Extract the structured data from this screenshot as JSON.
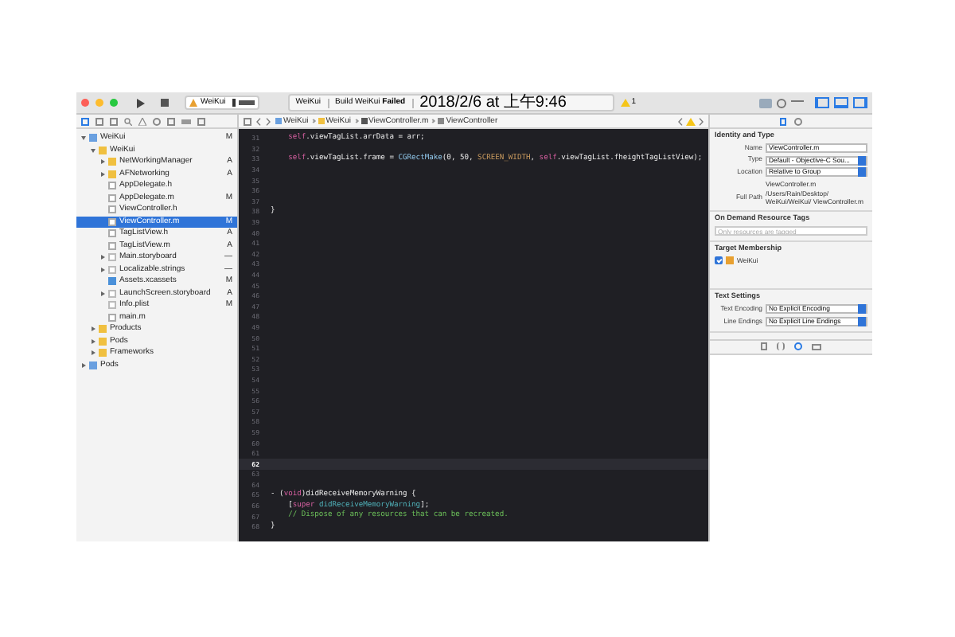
{
  "toolbar": {
    "scheme": "WeiKui",
    "status": {
      "project": "WeiKui",
      "message": "Build WeiKui **Failed**",
      "time": "2018/2/6 at 上午9:46"
    },
    "warning_count": "1"
  },
  "jump_bar": [
    "WeiKui",
    "WeiKui",
    "ViewController.m",
    "ViewController"
  ],
  "navigator": [
    {
      "name": "WeiKui",
      "kind": "project",
      "badge": "M",
      "expanded": true,
      "selected": false,
      "children": [
        {
          "name": "WeiKui",
          "kind": "folder",
          "expanded": true,
          "selected": false,
          "children": [
            {
              "name": "NetWorkingManager",
              "kind": "folder",
              "badge": "A",
              "expanded": false,
              "selected": false
            },
            {
              "name": "AFNetworking",
              "kind": "folder",
              "badge": "A",
              "expanded": false,
              "selected": false
            },
            {
              "name": "AppDelegate.h",
              "kind": "header",
              "selected": false
            },
            {
              "name": "AppDelegate.m",
              "kind": "source",
              "badge": "M",
              "selected": false
            },
            {
              "name": "ViewController.h",
              "kind": "header",
              "selected": false
            },
            {
              "name": "ViewController.m",
              "kind": "source",
              "badge": "M",
              "selected": true
            },
            {
              "name": "TagListView.h",
              "kind": "header",
              "badge": "A",
              "selected": false
            },
            {
              "name": "TagListView.m",
              "kind": "source",
              "badge": "A",
              "selected": false
            },
            {
              "name": "Main.storyboard",
              "kind": "doc",
              "badge": "—",
              "expanded": false,
              "selected": false
            },
            {
              "name": "Localizable.strings",
              "kind": "doc",
              "badge": "—",
              "expanded": false,
              "selected": false
            },
            {
              "name": "Assets.xcassets",
              "kind": "assets",
              "badge": "M",
              "selected": false
            },
            {
              "name": "LaunchScreen.storyboard",
              "kind": "doc",
              "badge": "A",
              "expanded": false,
              "selected": false
            },
            {
              "name": "Info.plist",
              "kind": "doc",
              "badge": "M",
              "selected": false
            },
            {
              "name": "main.m",
              "kind": "source",
              "selected": false
            }
          ]
        },
        {
          "name": "Products",
          "kind": "folder",
          "expanded": false,
          "selected": false
        },
        {
          "name": "Pods",
          "kind": "folder",
          "expanded": false,
          "selected": false
        },
        {
          "name": "Frameworks",
          "kind": "folder",
          "expanded": false,
          "selected": false
        }
      ]
    },
    {
      "name": "Pods",
      "kind": "project",
      "expanded": false,
      "selected": false
    }
  ],
  "editor": {
    "lines": [
      {
        "number": "31",
        "current": false,
        "segments": [
          {
            "kind": "keyword",
            "text": "    self"
          },
          {
            "kind": "plain",
            "text": ".viewTagList.arrData = arr;"
          }
        ]
      },
      {
        "number": "32",
        "current": false
      },
      {
        "number": "33",
        "current": false,
        "segments": [
          {
            "kind": "keyword",
            "text": "    self"
          },
          {
            "kind": "plain",
            "text": ".viewTagList.frame = "
          },
          {
            "kind": "function",
            "text": "CGRectMake"
          },
          {
            "kind": "plain",
            "text": "(0, 50, "
          },
          {
            "kind": "macro",
            "text": "SCREEN_WIDTH"
          },
          {
            "kind": "plain",
            "text": ", "
          },
          {
            "kind": "keyword",
            "text": "self"
          },
          {
            "kind": "plain",
            "text": ".viewTagList.fheightTagListView);"
          }
        ]
      },
      {
        "number": "34",
        "current": false
      },
      {
        "number": "35",
        "current": false
      },
      {
        "number": "36",
        "current": false
      },
      {
        "number": "37",
        "current": false
      },
      {
        "number": "38",
        "current": false,
        "segments": [
          {
            "kind": "plain",
            "text": "}"
          }
        ]
      },
      {
        "number": "39",
        "current": false
      },
      {
        "number": "40",
        "current": false
      },
      {
        "number": "41",
        "current": false
      },
      {
        "number": "42",
        "current": false
      },
      {
        "number": "43",
        "current": false
      },
      {
        "number": "44",
        "current": false
      },
      {
        "number": "45",
        "current": false
      },
      {
        "number": "46",
        "current": false
      },
      {
        "number": "47",
        "current": false
      },
      {
        "number": "48",
        "current": false
      },
      {
        "number": "49",
        "current": false
      },
      {
        "number": "50",
        "current": false
      },
      {
        "number": "51",
        "current": false
      },
      {
        "number": "52",
        "current": false
      },
      {
        "number": "53",
        "current": false
      },
      {
        "number": "54",
        "current": false
      },
      {
        "number": "55",
        "current": false
      },
      {
        "number": "56",
        "current": false
      },
      {
        "number": "57",
        "current": false
      },
      {
        "number": "58",
        "current": false
      },
      {
        "number": "59",
        "current": false
      },
      {
        "number": "60",
        "current": false
      },
      {
        "number": "61",
        "current": false
      },
      {
        "number": "62",
        "current": true
      },
      {
        "number": "63",
        "current": false
      },
      {
        "number": "64",
        "current": false
      },
      {
        "number": "65",
        "current": false,
        "segments": [
          {
            "kind": "plain",
            "text": "- ("
          },
          {
            "kind": "keyword",
            "text": "void"
          },
          {
            "kind": "plain",
            "text": ")didReceiveMemoryWarning {"
          }
        ]
      },
      {
        "number": "66",
        "current": false,
        "segments": [
          {
            "kind": "plain",
            "text": "    ["
          },
          {
            "kind": "keyword",
            "text": "super"
          },
          {
            "kind": "method",
            "text": " didReceiveMemoryWarning"
          },
          {
            "kind": "plain",
            "text": "];"
          }
        ]
      },
      {
        "number": "67",
        "current": false,
        "segments": [
          {
            "kind": "comment",
            "text": "    // Dispose of any resources that can be recreated."
          }
        ]
      },
      {
        "number": "68",
        "current": false,
        "segments": [
          {
            "kind": "plain",
            "text": "}"
          }
        ]
      }
    ]
  },
  "inspector": {
    "sections": [
      {
        "title": "Identity and Type",
        "rows": [
          {
            "kind": "field",
            "label": "Name",
            "value": "ViewController.m"
          },
          {
            "kind": "popup",
            "label": "Type",
            "value": "Default - Objective-C Sou..."
          },
          {
            "kind": "popup",
            "label": "Location",
            "value": "Relative to Group"
          },
          {
            "kind": "text",
            "value": "ViewController.m"
          },
          {
            "kind": "text",
            "label": "Full Path",
            "value": "/Users/Rain/Desktop/ WeiKui/WeiKui/ ViewController.m"
          }
        ]
      },
      {
        "title": "On Demand Resource Tags",
        "rows": [
          {
            "kind": "tags",
            "placeholder": "Only resources are tagged"
          }
        ]
      },
      {
        "title": "Target Membership",
        "rows": [
          {
            "kind": "checkbox",
            "value": "WeiKui",
            "checked": true
          }
        ]
      },
      {
        "title": "Text Settings",
        "rows": [
          {
            "kind": "popup",
            "label": "Text Encoding",
            "value": "No Explicit Encoding"
          },
          {
            "kind": "popup",
            "label": "Line Endings",
            "value": "No Explicit Line Endings"
          }
        ]
      }
    ]
  }
}
